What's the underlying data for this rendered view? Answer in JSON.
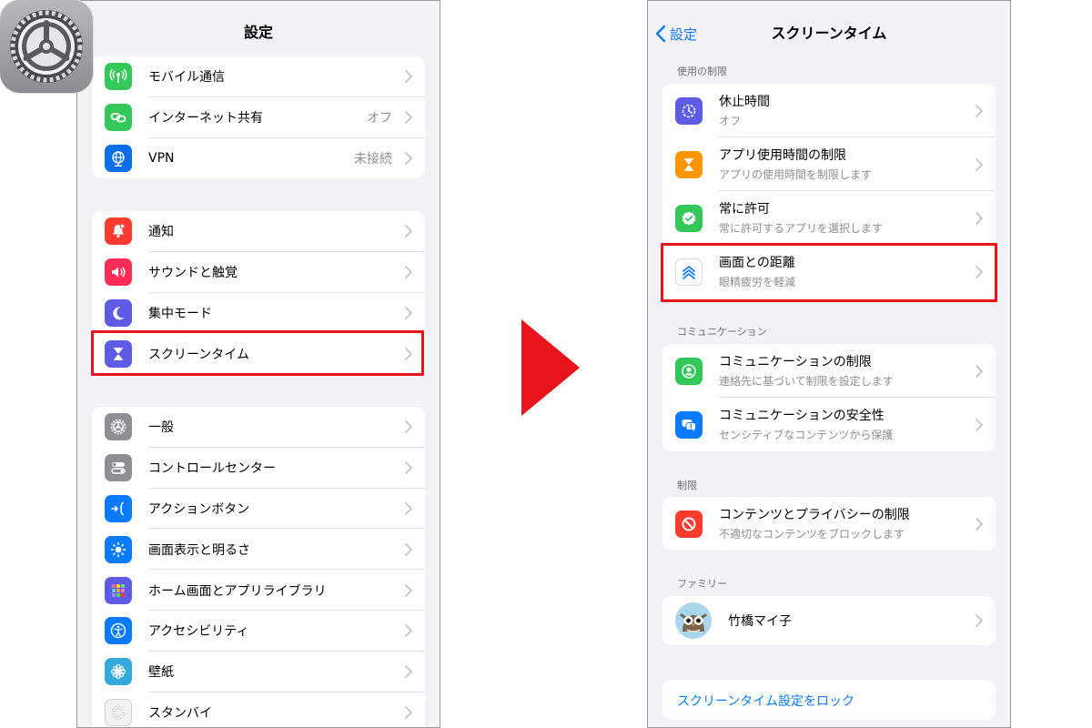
{
  "left": {
    "title": "設定",
    "group1": [
      {
        "label": "モバイル通信",
        "value": "",
        "icon": "antenna-icon",
        "color": "#34c759"
      },
      {
        "label": "インターネット共有",
        "value": "オフ",
        "icon": "link-icon",
        "color": "#34c759"
      },
      {
        "label": "VPN",
        "value": "未接続",
        "icon": "globe-icon",
        "color": "#0a6ee8"
      }
    ],
    "group2": [
      {
        "label": "通知",
        "icon": "bell-icon",
        "color": "#ff3b30"
      },
      {
        "label": "サウンドと触覚",
        "icon": "speaker-icon",
        "color": "#ff2d55"
      },
      {
        "label": "集中モード",
        "icon": "moon-icon",
        "color": "#5e5ce6"
      },
      {
        "label": "スクリーンタイム",
        "icon": "hourglass-icon",
        "color": "#5e5ce6"
      }
    ],
    "group3": [
      {
        "label": "一般",
        "icon": "gear-icon",
        "color": "#8e8e93"
      },
      {
        "label": "コントロールセンター",
        "icon": "toggles-icon",
        "color": "#8e8e93"
      },
      {
        "label": "アクションボタン",
        "icon": "action-button-icon",
        "color": "#0a7aff"
      },
      {
        "label": "画面表示と明るさ",
        "icon": "sun-icon",
        "color": "#0a7aff"
      },
      {
        "label": "ホーム画面とアプリライブラリ",
        "icon": "app-grid-icon",
        "color": "#5e5ce6"
      },
      {
        "label": "アクセシビリティ",
        "icon": "accessibility-icon",
        "color": "#0a7aff"
      },
      {
        "label": "壁紙",
        "icon": "flower-icon",
        "color": "#34aadc"
      },
      {
        "label": "スタンバイ",
        "icon": "standby-icon",
        "color": "#1c1c1e"
      }
    ]
  },
  "right": {
    "back_label": "設定",
    "title": "スクリーンタイム",
    "sections": {
      "usage_limits": "使用の制限",
      "communication": "コミュニケーション",
      "restrictions": "制限",
      "family": "ファミリー"
    },
    "usage": [
      {
        "title": "休止時間",
        "subtitle": "オフ",
        "icon": "downtime-icon",
        "color": "#5e5ce6"
      },
      {
        "title": "アプリ使用時間の制限",
        "subtitle": "アプリの使用時間を制限します",
        "icon": "hourglass-icon",
        "color": "#ff9500"
      },
      {
        "title": "常に許可",
        "subtitle": "常に許可するアプリを選択します",
        "icon": "checkmark-badge-icon",
        "color": "#34c759"
      },
      {
        "title": "画面との距離",
        "subtitle": "眼精疲労を軽減",
        "icon": "chevrons-up-icon",
        "color": "#0a7aff"
      }
    ],
    "communication": [
      {
        "title": "コミュニケーションの制限",
        "subtitle": "連絡先に基づいて制限を設定します",
        "icon": "person-circle-icon",
        "color": "#34c759"
      },
      {
        "title": "コミュニケーションの安全性",
        "subtitle": "センシティブなコンテンツから保護",
        "icon": "chat-bubble-icon",
        "color": "#0a7aff"
      }
    ],
    "restrictions": [
      {
        "title": "コンテンツとプライバシーの制限",
        "subtitle": "不適切なコンテンツをブロックします",
        "icon": "prohibited-icon",
        "color": "#ff3b30"
      }
    ],
    "family_member": {
      "name": "竹橋マイ子",
      "icon": "owl-avatar-icon"
    },
    "lock_label": "スクリーンタイム設定をロック"
  },
  "accent": "#0a7aff",
  "highlight_color": "#e8141b",
  "arrow_color": "#e8141b"
}
